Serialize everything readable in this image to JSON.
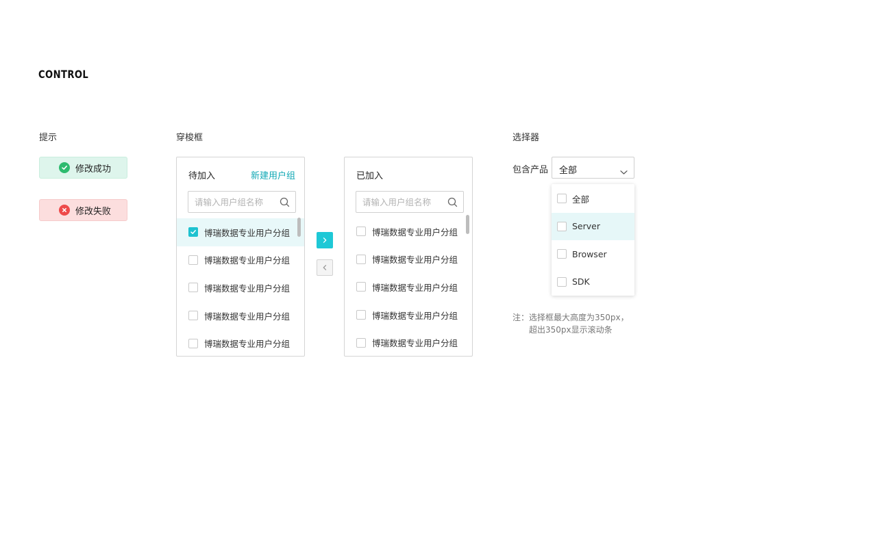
{
  "heading": "CONTROL",
  "sections": {
    "tips": "提示",
    "transfer": "穿梭框",
    "selector": "选择器"
  },
  "toasts": {
    "success": "修改成功",
    "error": "修改失败"
  },
  "transfer": {
    "left": {
      "title": "待加入",
      "link": "新建用户组",
      "search_placeholder": "请输入用户组名称",
      "items": [
        {
          "label": "博瑞数据专业用户分组",
          "checked": true
        },
        {
          "label": "博瑞数据专业用户分组",
          "checked": false
        },
        {
          "label": "博瑞数据专业用户分组",
          "checked": false
        },
        {
          "label": "博瑞数据专业用户分组",
          "checked": false
        },
        {
          "label": "博瑞数据专业用户分组",
          "checked": false
        }
      ]
    },
    "right": {
      "title": "已加入",
      "search_placeholder": "请输入用户组名称",
      "items": [
        {
          "label": "博瑞数据专业用户分组",
          "checked": false
        },
        {
          "label": "博瑞数据专业用户分组",
          "checked": false
        },
        {
          "label": "博瑞数据专业用户分组",
          "checked": false
        },
        {
          "label": "博瑞数据专业用户分组",
          "checked": false
        },
        {
          "label": "博瑞数据专业用户分组",
          "checked": false
        }
      ]
    }
  },
  "selector": {
    "label": "包含产品",
    "value": "全部",
    "options": [
      "全部",
      "Server",
      "Browser",
      "SDK"
    ],
    "note_line1": "注：选择框最大高度为350px，",
    "note_line2": "超出350px显示滚动条"
  },
  "colors": {
    "accent": "#1ec8d6",
    "success": "#2ebb6f",
    "error": "#ee4a4a"
  }
}
